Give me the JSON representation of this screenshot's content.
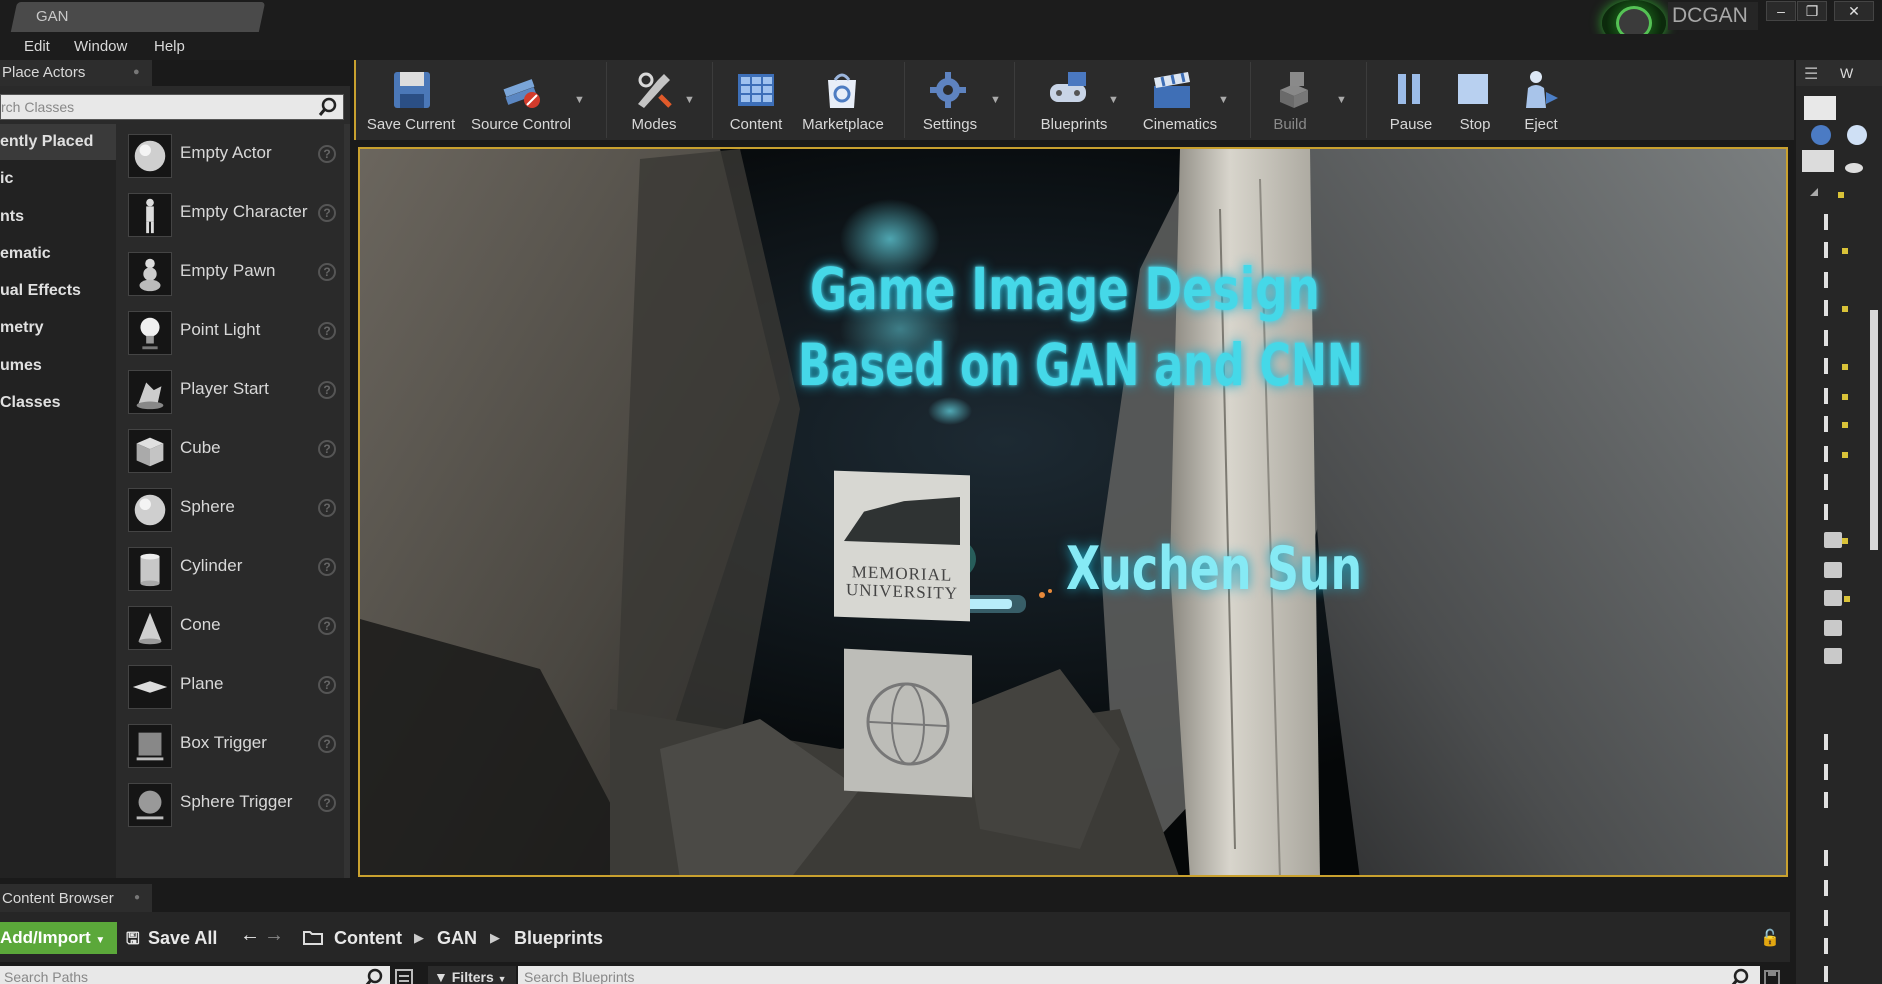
{
  "window": {
    "doc_tab": "GAN",
    "app_name": "DCGAN",
    "controls": [
      "–",
      "❐",
      "✕"
    ]
  },
  "menu": [
    "Edit",
    "Window",
    "Help"
  ],
  "place_actors": {
    "tab_label": "Place Actors",
    "search_placeholder": "rch Classes",
    "categories": [
      "ently Placed",
      "ic",
      "nts",
      "ematic",
      "ual Effects",
      "metry",
      "umes",
      "Classes"
    ],
    "actors": [
      "Empty Actor",
      "Empty Character",
      "Empty Pawn",
      "Point Light",
      "Player Start",
      "Cube",
      "Sphere",
      "Cylinder",
      "Cone",
      "Plane",
      "Box Trigger",
      "Sphere Trigger"
    ]
  },
  "toolbar": {
    "save_current": "Save Current",
    "source_control": "Source Control",
    "modes": "Modes",
    "content": "Content",
    "marketplace": "Marketplace",
    "settings": "Settings",
    "blueprints": "Blueprints",
    "cinematics": "Cinematics",
    "build": "Build",
    "pause": "Pause",
    "stop": "Stop",
    "eject": "Eject"
  },
  "viewport": {
    "title_line1": "Game Image Design",
    "title_line2": "Based on GAN and CNN",
    "author": "Xuchen Sun",
    "sign_line1": "MEMORIAL",
    "sign_line2": "UNIVERSITY"
  },
  "outliner": {
    "header": "W"
  },
  "content_browser": {
    "tab_label": "Content Browser",
    "add_import": "Add/Import",
    "save_all": "Save All",
    "breadcrumb": [
      "Content",
      "GAN",
      "Blueprints"
    ],
    "search_paths_placeholder": "Search Paths",
    "filters": "Filters",
    "search_blueprints_placeholder": "Search Blueprints"
  },
  "colors": {
    "accent": "#c9a12f",
    "add_import_green": "#5ba83a",
    "title_glow": "#45d8e8"
  }
}
